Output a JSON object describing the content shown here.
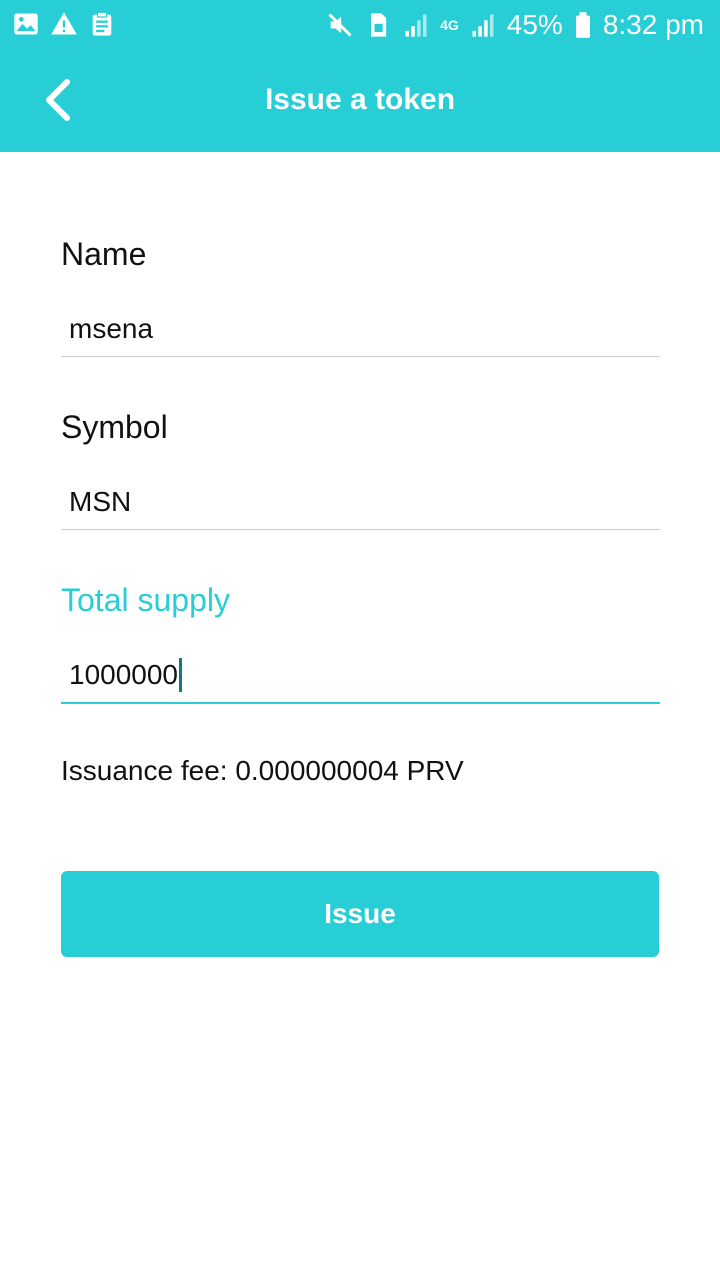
{
  "status_bar": {
    "battery": "45%",
    "time": "8:32 pm",
    "network": "4G",
    "icons_left": [
      "image-icon",
      "warning-icon",
      "clipboard-icon"
    ],
    "icons_right": [
      "mute-icon",
      "sim-icon",
      "signal-icon",
      "signal-icon",
      "battery-icon"
    ]
  },
  "header": {
    "title": "Issue a token",
    "back_icon": "chevron-left-icon"
  },
  "form": {
    "name": {
      "label": "Name",
      "value": "msena"
    },
    "symbol": {
      "label": "Symbol",
      "value": "MSN"
    },
    "total_supply": {
      "label": "Total supply",
      "value": "1000000"
    },
    "fee_text": "Issuance fee: 0.000000004 PRV"
  },
  "actions": {
    "issue_label": "Issue"
  },
  "colors": {
    "accent": "#27ced6",
    "text": "#111111",
    "divider": "#cfcfcf"
  }
}
